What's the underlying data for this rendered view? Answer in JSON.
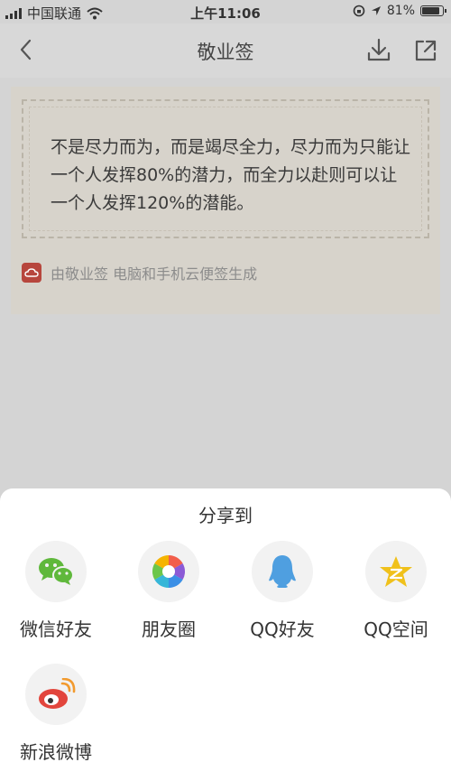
{
  "status_bar": {
    "carrier": "中国联通",
    "time": "上午11:06",
    "battery": "81%"
  },
  "nav": {
    "title": "敬业签",
    "back_icon": "chevron-left-icon",
    "download_icon": "download-icon",
    "share_icon": "share-out-icon"
  },
  "card": {
    "quote": "不是尽力而为，而是竭尽全力，尽力而为只能让一个人发挥80%的潜力，而全力以赴则可以让一个人发挥120%的潜能。",
    "brand_text": "由敬业签 电脑和手机云便签生成"
  },
  "share_sheet": {
    "title": "分享到",
    "items": [
      {
        "label": "微信好友",
        "icon": "wechat-icon"
      },
      {
        "label": "朋友圈",
        "icon": "moments-icon"
      },
      {
        "label": "QQ好友",
        "icon": "qq-icon"
      },
      {
        "label": "QQ空间",
        "icon": "qzone-icon"
      },
      {
        "label": "新浪微博",
        "icon": "weibo-icon"
      }
    ]
  },
  "colors": {
    "wechat_green": "#5fb83b",
    "qq_blue": "#4f9fe0",
    "qzone_yellow": "#f0c11b",
    "weibo_red": "#e2453c",
    "brand_red": "#b7463d"
  }
}
